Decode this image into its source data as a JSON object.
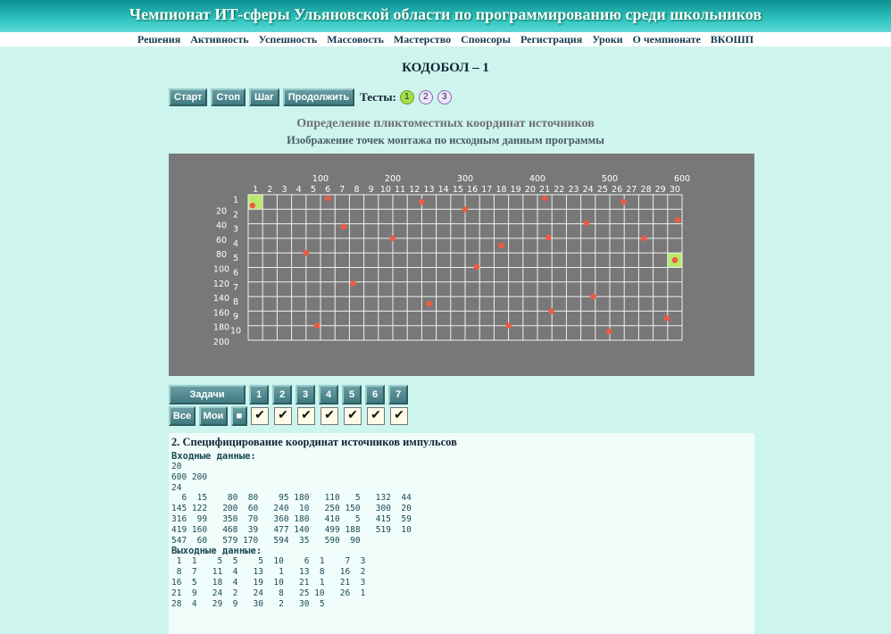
{
  "header": {
    "title": "Чемпионат ИТ-сферы Ульяновской области по программированию среди школьников"
  },
  "nav": {
    "items": [
      "Решения",
      "Активность",
      "Успешность",
      "Массовость",
      "Мастерство",
      "Спонсоры",
      "Регистрация",
      "Уроки",
      "О чемпионате",
      "ВКОШП"
    ]
  },
  "page_title": "КОДОБОЛ – 1",
  "controls": {
    "start": "Старт",
    "stop": "Стоп",
    "step": "Шаг",
    "continue": "Продолжить",
    "tests_label": "Тесты:",
    "tests": [
      "1",
      "2",
      "3"
    ],
    "active_test": 0
  },
  "chart_title": "Определение пликтоместных координат источников",
  "chart_subtitle": "Изображение точек монтажа по исходным данным программы",
  "chart_data": {
    "type": "scatter",
    "grid_cols": 30,
    "grid_rows": 10,
    "col_labels": [
      "1",
      "2",
      "3",
      "4",
      "5",
      "6",
      "7",
      "8",
      "9",
      "10",
      "11",
      "12",
      "13",
      "14",
      "15",
      "16",
      "17",
      "18",
      "19",
      "20",
      "21",
      "22",
      "23",
      "24",
      "25",
      "26",
      "27",
      "28",
      "29",
      "30"
    ],
    "row_labels": [
      "1",
      "2",
      "3",
      "4",
      "5",
      "6",
      "7",
      "8",
      "9",
      "10"
    ],
    "x_ticks": [
      "100",
      "200",
      "300",
      "400",
      "500",
      "600"
    ],
    "y_ticks": [
      "20",
      "40",
      "60",
      "80",
      "100",
      "120",
      "140",
      "160",
      "180",
      "200"
    ],
    "xlim": [
      0,
      600
    ],
    "ylim": [
      0,
      200
    ],
    "points": [
      [
        6,
        15
      ],
      [
        80,
        80
      ],
      [
        95,
        180
      ],
      [
        110,
        5
      ],
      [
        132,
        44
      ],
      [
        145,
        122
      ],
      [
        200,
        60
      ],
      [
        240,
        10
      ],
      [
        250,
        150
      ],
      [
        300,
        20
      ],
      [
        316,
        99
      ],
      [
        350,
        70
      ],
      [
        360,
        180
      ],
      [
        410,
        5
      ],
      [
        415,
        59
      ],
      [
        419,
        160
      ],
      [
        468,
        39
      ],
      [
        477,
        140
      ],
      [
        499,
        188
      ],
      [
        519,
        10
      ],
      [
        547,
        60
      ],
      [
        579,
        170
      ],
      [
        594,
        35
      ],
      [
        590,
        90
      ]
    ],
    "highlighted_cells": [
      [
        1,
        1
      ],
      [
        30,
        5
      ]
    ],
    "colors": {
      "background": "#787878",
      "grid": "#f0f0f0",
      "point": "#ee5a44",
      "highlight": "#b8ea6a"
    }
  },
  "tasks": {
    "label": "Задачи",
    "numbers": [
      "1",
      "2",
      "3",
      "4",
      "5",
      "6",
      "7"
    ],
    "all": "Все",
    "mine": "Мои",
    "square": "■",
    "check": "✔"
  },
  "task": {
    "heading": "2. Специфицирование координат источников импульсов",
    "input_label": "Входные данные:",
    "input_lines": [
      "20",
      "600 200",
      "24",
      "  6  15    80  80    95 180   110   5   132  44",
      "145 122   200  60   240  10   250 150   300  20",
      "316  99   350  70   360 180   410   5   415  59",
      "419 160   468  39   477 140   499 188   519  10",
      "547  60   579 170   594  35   590  90"
    ],
    "output_label": "Выходные данные:",
    "output_lines": [
      " 1  1    5  5    5  10    6  1    7  3",
      " 8  7   11  4   13   1   13  8   16  2",
      "16  5   18  4   19  10   21  1   21  3",
      "21  9   24  2   24   8   25 10   26  1",
      "28  4   29  9   30   2   30  5"
    ]
  }
}
